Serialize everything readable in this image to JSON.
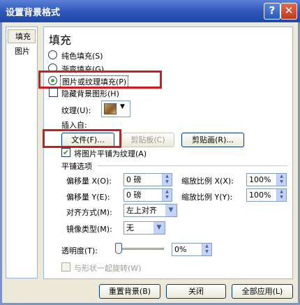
{
  "window": {
    "title": "设置背景格式",
    "help_icon": "?",
    "close_icon": "✕"
  },
  "nav": {
    "items": [
      {
        "label": "填充",
        "selected": true
      },
      {
        "label": "图片",
        "selected": false
      }
    ]
  },
  "fill": {
    "heading": "填充",
    "options": [
      {
        "label": "纯色填充(S)",
        "checked": false
      },
      {
        "label": "渐变填充(G)",
        "checked": false
      },
      {
        "label": "图片或纹理填充(P)",
        "checked": true
      }
    ],
    "hide_bg_graphics": {
      "label": "隐藏背景图形(H)",
      "checked": false
    },
    "texture_label": "纹理(U):",
    "insert_from_label": "插入自:",
    "file_button": "文件(F)...",
    "clipboard_button": "剪贴板(C)",
    "clipart_button": "剪贴画(R)...",
    "tile_checkbox": {
      "label": "将图片平铺为纹理(A)",
      "checked": true
    },
    "tile_options_heading": "平铺选项",
    "offset_x": {
      "label": "偏移量 X(O):",
      "value": "0 磅"
    },
    "offset_y": {
      "label": "偏移量 Y(E):",
      "value": "0 磅"
    },
    "scale_x": {
      "label": "缩放比例 X(X):",
      "value": "100%"
    },
    "scale_y": {
      "label": "缩放比例 Y(Y):",
      "value": "100%"
    },
    "alignment": {
      "label": "对齐方式(M):",
      "value": "左上对齐"
    },
    "mirror": {
      "label": "镜像类型(M):",
      "value": "无"
    },
    "transparency": {
      "label": "透明度(T):",
      "value": "0%",
      "level": 0
    },
    "rotate_with_shape": {
      "label": "与形状一起旋转(W)",
      "checked": false,
      "enabled": false
    }
  },
  "footer": {
    "reset_button": "重置背景(B)",
    "close_button": "关闭",
    "apply_all_button": "全部应用(L)"
  },
  "colors": {
    "highlight_box": "#d01c1c",
    "radio_dot": "#3db339",
    "titlebar": "#2d55b8"
  }
}
